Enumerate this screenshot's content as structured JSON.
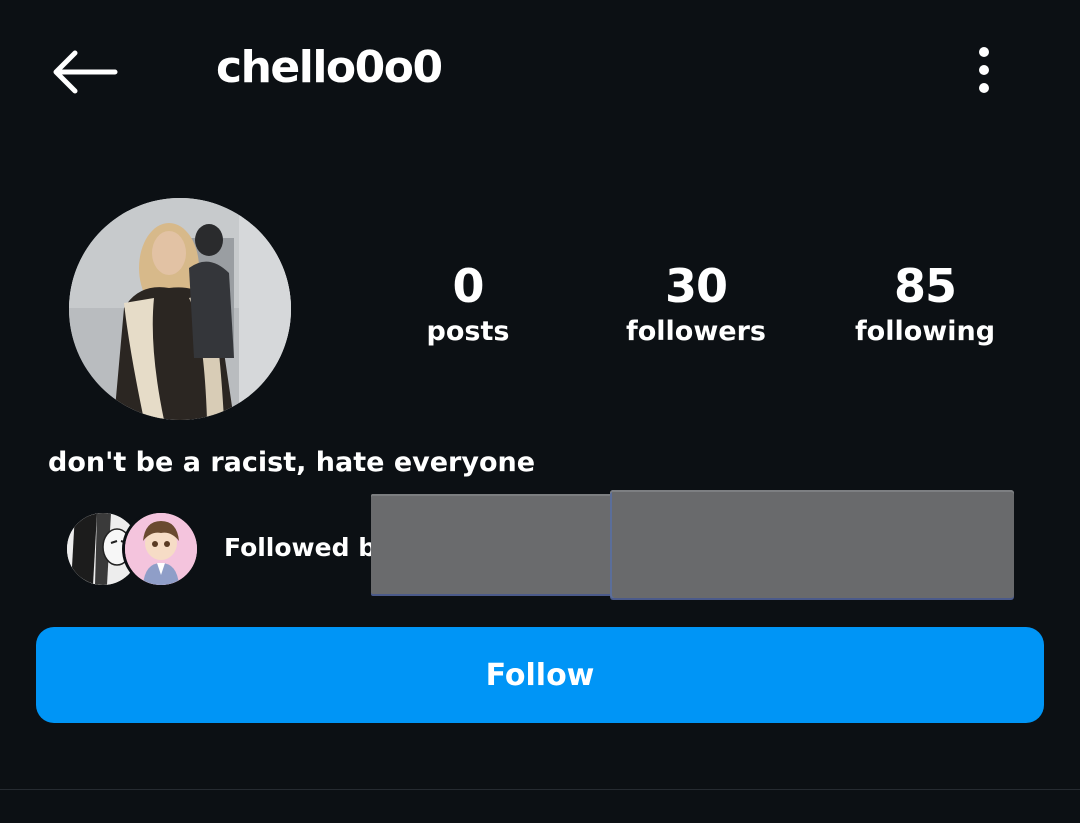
{
  "header": {
    "username": "chello0o0",
    "back_icon": "arrow-left-icon",
    "more_icon": "more-vertical-icon"
  },
  "stats": {
    "posts": {
      "value": "0",
      "label": "posts"
    },
    "followers": {
      "value": "30",
      "label": "followers"
    },
    "following": {
      "value": "85",
      "label": "following"
    }
  },
  "bio": "don't be a racist, hate everyone",
  "followed_by": {
    "label": "Followed by"
  },
  "follow_button": {
    "label": "Follow"
  },
  "colors": {
    "background": "#0c1014",
    "accent": "#0095f6",
    "text": "#ffffff"
  }
}
